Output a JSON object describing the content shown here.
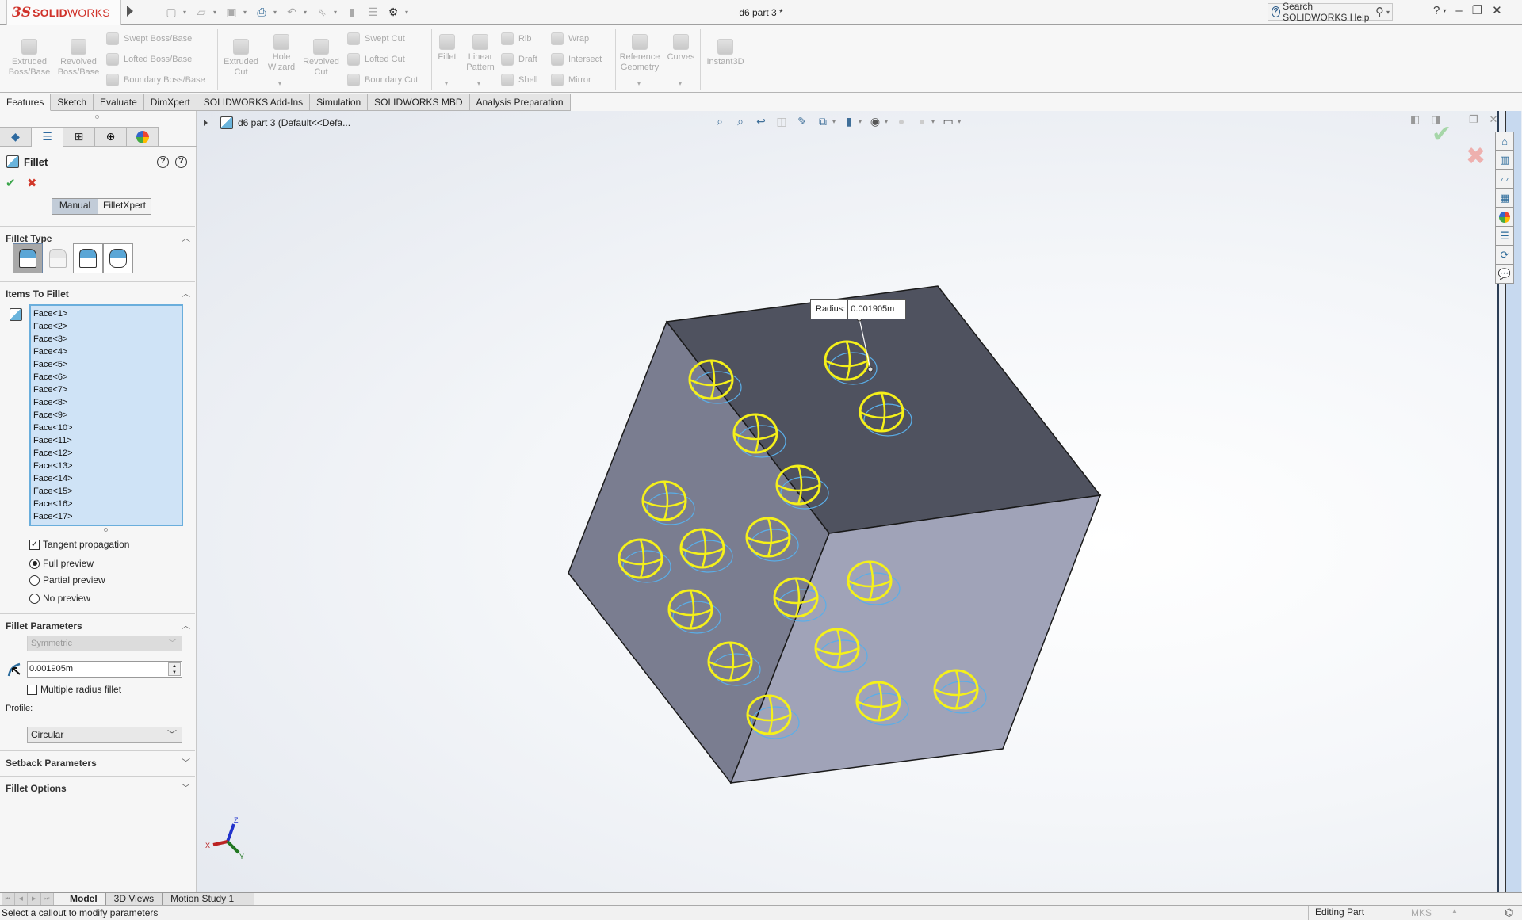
{
  "app": {
    "brand_prefix": "3S",
    "brand_bold": "SOLID",
    "brand_light": "WORKS",
    "document_title": "d6 part 3 *",
    "help_search_placeholder": "Search SOLIDWORKS Help",
    "quick_access": [
      "new-icon",
      "open-icon",
      "save-icon",
      "print-icon",
      "undo-icon",
      "select-icon",
      "rebuild-icon",
      "file-properties-icon",
      "options-icon"
    ],
    "window_controls": [
      "help-icon",
      "minimize-icon",
      "restore-icon",
      "close-icon"
    ]
  },
  "ribbon": {
    "groups": [
      {
        "large": [
          {
            "label": "Extruded Boss/Base"
          },
          {
            "label": "Revolved Boss/Base"
          }
        ],
        "small": [
          {
            "label": "Swept Boss/Base"
          },
          {
            "label": "Lofted Boss/Base"
          },
          {
            "label": "Boundary Boss/Base"
          }
        ]
      },
      {
        "large": [
          {
            "label": "Extruded Cut"
          },
          {
            "label": "Hole Wizard"
          },
          {
            "label": "Revolved Cut"
          }
        ],
        "small": [
          {
            "label": "Swept Cut"
          },
          {
            "label": "Lofted Cut"
          },
          {
            "label": "Boundary Cut"
          }
        ]
      },
      {
        "large": [
          {
            "label": "Fillet"
          },
          {
            "label": "Linear Pattern"
          }
        ],
        "small": [
          {
            "label": "Rib"
          },
          {
            "label": "Draft"
          },
          {
            "label": "Shell"
          },
          {
            "label": "Wrap"
          },
          {
            "label": "Intersect"
          },
          {
            "label": "Mirror"
          }
        ]
      },
      {
        "large": [
          {
            "label": "Reference Geometry"
          },
          {
            "label": "Curves"
          }
        ]
      },
      {
        "large": [
          {
            "label": "Instant3D"
          }
        ]
      }
    ]
  },
  "tabs": [
    {
      "label": "Features",
      "active": true
    },
    {
      "label": "Sketch"
    },
    {
      "label": "Evaluate"
    },
    {
      "label": "DimXpert"
    },
    {
      "label": "SOLIDWORKS Add-Ins"
    },
    {
      "label": "Simulation"
    },
    {
      "label": "SOLIDWORKS MBD"
    },
    {
      "label": "Analysis Preparation"
    }
  ],
  "panel": {
    "tabs": [
      "feature-manager-icon",
      "property-manager-icon",
      "configuration-manager-icon",
      "dimxpert-manager-icon",
      "display-manager-icon"
    ],
    "title": "Fillet",
    "ok_symbol": "✔",
    "cancel_symbol": "✖",
    "modes": {
      "manual": "Manual",
      "expert": "FilletXpert",
      "active": "Manual"
    },
    "sections": {
      "fillet_type": "Fillet Type",
      "items": "Items To Fillet",
      "parameters": "Fillet Parameters",
      "setback": "Setback Parameters",
      "options": "Fillet Options"
    },
    "fillet_types": [
      "constant-size-fillet",
      "variable-size-fillet",
      "face-fillet",
      "full-round-fillet"
    ],
    "faces": [
      "Face<1>",
      "Face<2>",
      "Face<3>",
      "Face<4>",
      "Face<5>",
      "Face<6>",
      "Face<7>",
      "Face<8>",
      "Face<9>",
      "Face<10>",
      "Face<11>",
      "Face<12>",
      "Face<13>",
      "Face<14>",
      "Face<15>",
      "Face<16>",
      "Face<17>"
    ],
    "tangent_propagation": {
      "label": "Tangent propagation",
      "checked": true
    },
    "preview_options": [
      {
        "label": "Full preview",
        "selected": true
      },
      {
        "label": "Partial preview",
        "selected": false
      },
      {
        "label": "No preview",
        "selected": false
      }
    ],
    "symmetric_select": "Symmetric",
    "radius_value": "0.001905m",
    "multiple_radius": {
      "label": "Multiple radius fillet",
      "checked": false
    },
    "profile_label": "Profile:",
    "profile_value": "Circular"
  },
  "viewport": {
    "tree_root": "d6 part 3  (Default<<Defa...",
    "callout_label": "Radius:",
    "callout_value": "0.001905m",
    "triad": {
      "x": "X",
      "y": "Y",
      "z": "Z"
    },
    "heads_up_toolbar": [
      "zoom-to-fit-icon",
      "zoom-to-area-icon",
      "previous-view-icon",
      "section-view-icon",
      "dynamic-annotation-icon",
      "view-orientation-icon",
      "display-style-icon",
      "hide-show-items-icon",
      "edit-appearance-icon",
      "apply-scene-icon",
      "view-settings-icon"
    ],
    "colors": {
      "top_face": "#4f525f",
      "left_face": "#7a7d90",
      "right_face": "#a0a3b8",
      "preview": "#f5f01a",
      "hole": "#5aaee8"
    }
  },
  "task_pane": [
    "home-icon",
    "design-library-icon",
    "file-explorer-icon",
    "view-palette-icon",
    "appearances-icon",
    "custom-properties-icon",
    "solidworks-forum-icon",
    "community-icon"
  ],
  "bottom_tabs": [
    {
      "label": "Model",
      "active": true
    },
    {
      "label": "3D Views"
    },
    {
      "label": "Motion Study 1"
    }
  ],
  "status": {
    "message": "Select a callout to modify parameters",
    "mode": "Editing Part",
    "units": "MKS"
  }
}
